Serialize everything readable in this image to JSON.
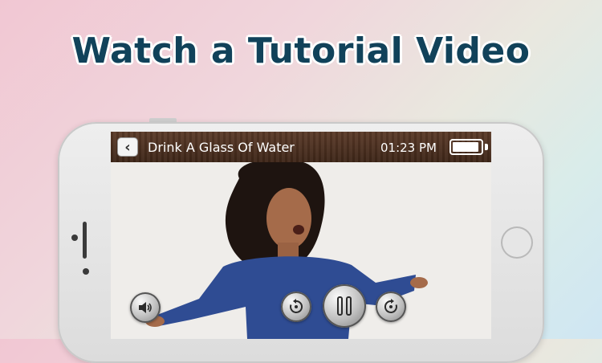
{
  "headline": "Watch a Tutorial Video",
  "player": {
    "video_title": "Drink A Glass Of Water",
    "time": "01:23 PM",
    "battery_level": 0.95
  },
  "icons": {
    "back": "chevron-left-icon",
    "volume": "volume-icon",
    "rewind": "rewind-icon",
    "pause": "pause-icon",
    "forward": "forward-icon",
    "battery": "battery-icon"
  }
}
